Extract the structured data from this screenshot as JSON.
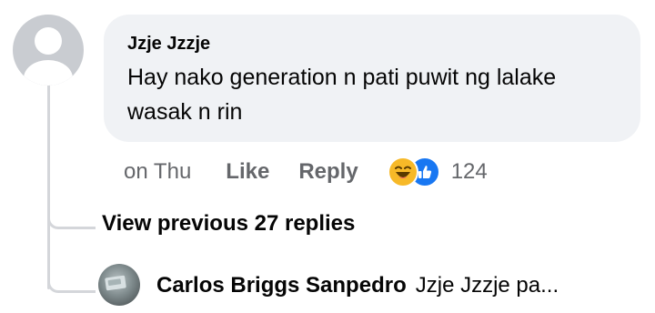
{
  "comment": {
    "author": "Jzje Jzzje",
    "text": "Hay nako generation n pati puwit ng lalake wasak n rin",
    "timestamp": "on Thu",
    "like_label": "Like",
    "reply_label": "Reply",
    "reaction_count": "124",
    "reactions": [
      "haha-icon",
      "like-icon"
    ]
  },
  "view_previous": "View previous 27 replies",
  "reply": {
    "author": "Carlos Briggs Sanpedro",
    "snippet": "Jzje Jzzje  pa..."
  },
  "colors": {
    "bubble": "#f0f2f5",
    "secondary_text": "#65676b",
    "haha": "#f7b928",
    "like": "#1877f2",
    "thread_line": "#d4d6da"
  }
}
